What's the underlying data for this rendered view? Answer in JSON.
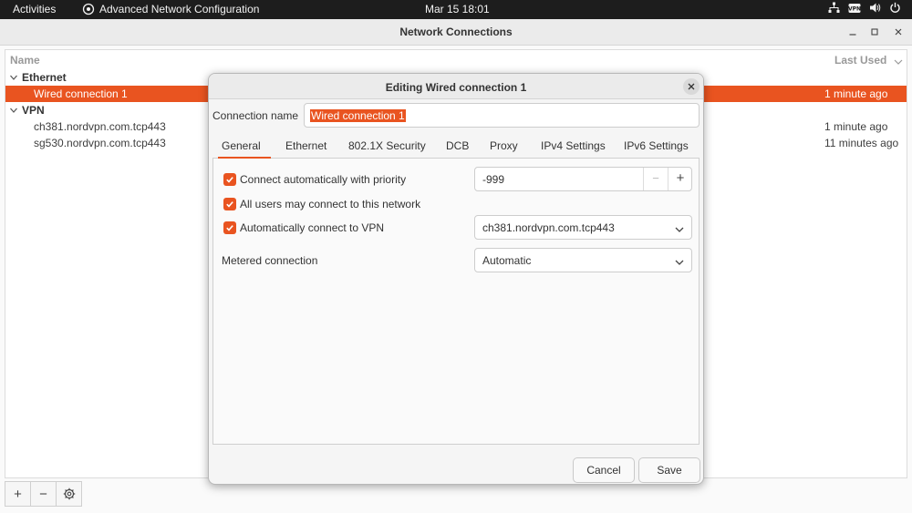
{
  "topbar": {
    "activities": "Activities",
    "app_name": "Advanced Network Configuration",
    "clock": "Mar 15  18:01",
    "tray_icons": [
      "network-icon",
      "vpn-icon",
      "volume-icon",
      "power-icon"
    ]
  },
  "window": {
    "title": "Network Connections",
    "columns": {
      "name": "Name",
      "last_used": "Last Used"
    },
    "groups": [
      {
        "label": "Ethernet"
      },
      {
        "label": "VPN"
      }
    ],
    "rows": [
      {
        "name": "Wired connection 1",
        "last_used": "1 minute ago"
      },
      {
        "name": "ch381.nordvpn.com.tcp443",
        "last_used": "1 minute ago"
      },
      {
        "name": "sg530.nordvpn.com.tcp443",
        "last_used": "11 minutes ago"
      }
    ],
    "toolbar": {
      "add": "+",
      "remove": "−"
    }
  },
  "dialog": {
    "title": "Editing Wired connection 1",
    "connection_name_label": "Connection name",
    "connection_name_value": "Wired connection 1",
    "tabs": [
      "General",
      "Ethernet",
      "802.1X Security",
      "DCB",
      "Proxy",
      "IPv4 Settings",
      "IPv6 Settings"
    ],
    "general": {
      "auto_connect_label": "Connect automatically with priority",
      "priority_value": "-999",
      "all_users_label": "All users may connect to this network",
      "auto_vpn_label": "Automatically connect to VPN",
      "vpn_value": "ch381.nordvpn.com.tcp443",
      "metered_label": "Metered connection",
      "metered_value": "Automatic"
    },
    "cancel_label": "Cancel",
    "save_label": "Save"
  },
  "colors": {
    "accent": "#e95420",
    "topbar": "#1d1d1d"
  }
}
